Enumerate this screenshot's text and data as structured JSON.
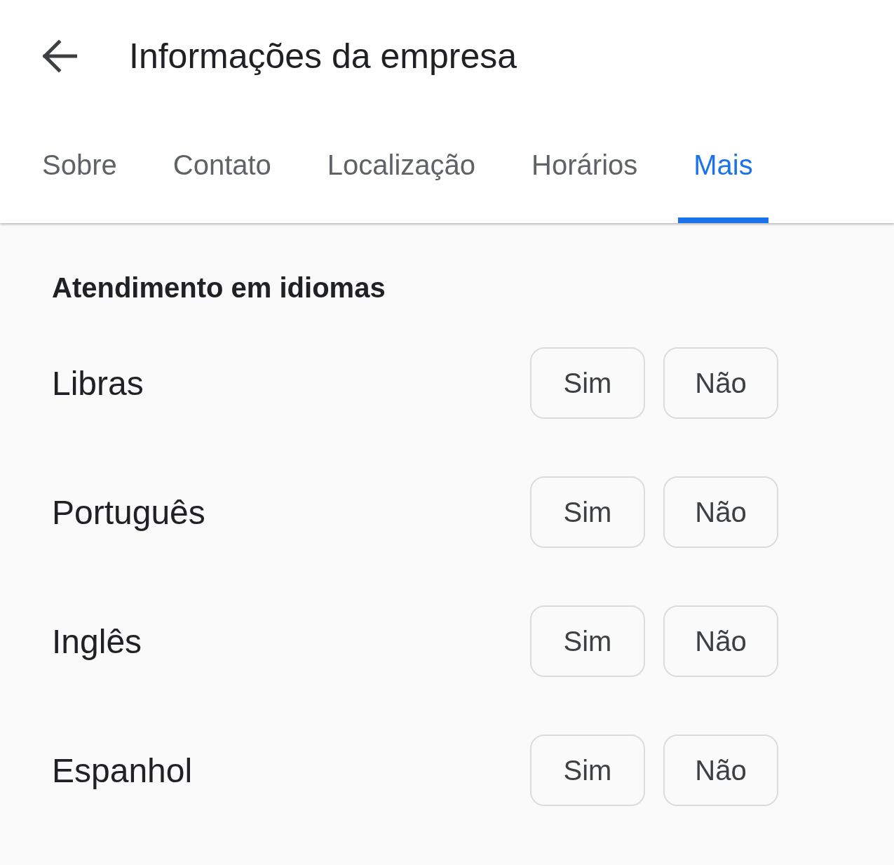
{
  "header": {
    "title": "Informações da empresa"
  },
  "tabs": [
    {
      "label": "Sobre",
      "selected": false
    },
    {
      "label": "Contato",
      "selected": false
    },
    {
      "label": "Localização",
      "selected": false
    },
    {
      "label": "Horários",
      "selected": false
    },
    {
      "label": "Mais",
      "selected": true
    }
  ],
  "section": {
    "title": "Atendimento em idiomas",
    "rows": [
      {
        "label": "Libras",
        "options": [
          {
            "label": "Sim",
            "selected": false
          },
          {
            "label": "Não",
            "selected": false
          }
        ]
      },
      {
        "label": "Português",
        "options": [
          {
            "label": "Sim",
            "selected": false
          },
          {
            "label": "Não",
            "selected": false
          }
        ]
      },
      {
        "label": "Inglês",
        "options": [
          {
            "label": "Sim",
            "selected": false
          },
          {
            "label": "Não",
            "selected": false
          }
        ]
      },
      {
        "label": "Espanhol",
        "options": [
          {
            "label": "Sim",
            "selected": false
          },
          {
            "label": "Não",
            "selected": false
          }
        ]
      }
    ]
  }
}
